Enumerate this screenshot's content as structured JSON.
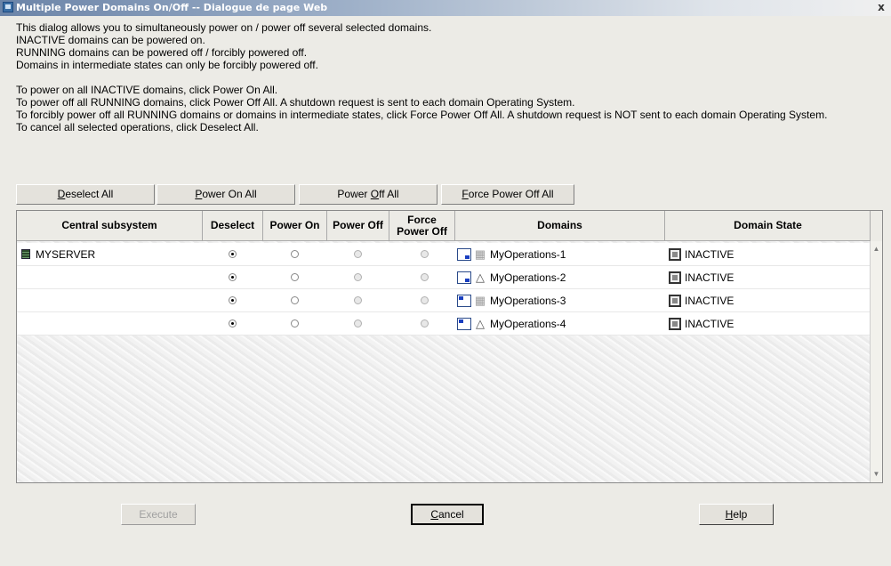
{
  "window": {
    "title": "Multiple Power Domains On/Off -- Dialogue de page Web",
    "close_label": "x"
  },
  "description": {
    "lines_a": [
      "This dialog allows you to simultaneously power on / power off several selected domains.",
      "INACTIVE domains can be powered on.",
      "RUNNING domains can be powered off / forcibly powered off.",
      "Domains in intermediate states can only be forcibly powered off."
    ],
    "lines_b": [
      "To power on all INACTIVE domains, click Power On All.",
      "To power off all RUNNING domains, click Power Off All. A shutdown request is sent to each domain Operating System.",
      "To forcibly power off all RUNNING domains or domains in intermediate states, click Force Power Off All. A shutdown request is NOT sent to each domain Operating System.",
      "To cancel all selected operations, click Deselect All."
    ]
  },
  "toolbar": {
    "deselect_all": {
      "mnemonic": "D",
      "rest": "eselect All"
    },
    "power_on_all": {
      "mnemonic": "P",
      "rest": "ower On All"
    },
    "power_off_all": {
      "pre": "Power ",
      "mnemonic": "O",
      "rest": "ff All"
    },
    "force_power_off_all": {
      "mnemonic": "F",
      "rest": "orce Power Off All"
    }
  },
  "table": {
    "headers": {
      "central_subsystem": "Central subsystem",
      "deselect": "Deselect",
      "power_on": "Power On",
      "power_off": "Power Off",
      "force_power_off_1": "Force",
      "force_power_off_2": "Power Off",
      "domains": "Domains",
      "domain_state": "Domain State"
    },
    "rows": [
      {
        "subsystem": "MYSERVER",
        "domain": "MyOperations-1",
        "os": "windows-icon",
        "state": "INACTIVE",
        "selected": "deselect"
      },
      {
        "subsystem": "",
        "domain": "MyOperations-2",
        "os": "linux-penguin-icon",
        "state": "INACTIVE",
        "selected": "deselect"
      },
      {
        "subsystem": "",
        "domain": "MyOperations-3",
        "os": "windows-icon",
        "state": "INACTIVE",
        "selected": "deselect"
      },
      {
        "subsystem": "",
        "domain": "MyOperations-4",
        "os": "linux-penguin-icon",
        "state": "INACTIVE",
        "selected": "deselect"
      }
    ]
  },
  "footer": {
    "execute": "Execute",
    "cancel": {
      "mnemonic": "C",
      "rest": "ancel"
    },
    "help": {
      "mnemonic": "H",
      "rest": "elp"
    }
  },
  "colors": {
    "dialog_bg": "#ecebe6",
    "title_gradient_start": "#6b84a8",
    "domain_icon_blue": "#1a3fc0"
  }
}
